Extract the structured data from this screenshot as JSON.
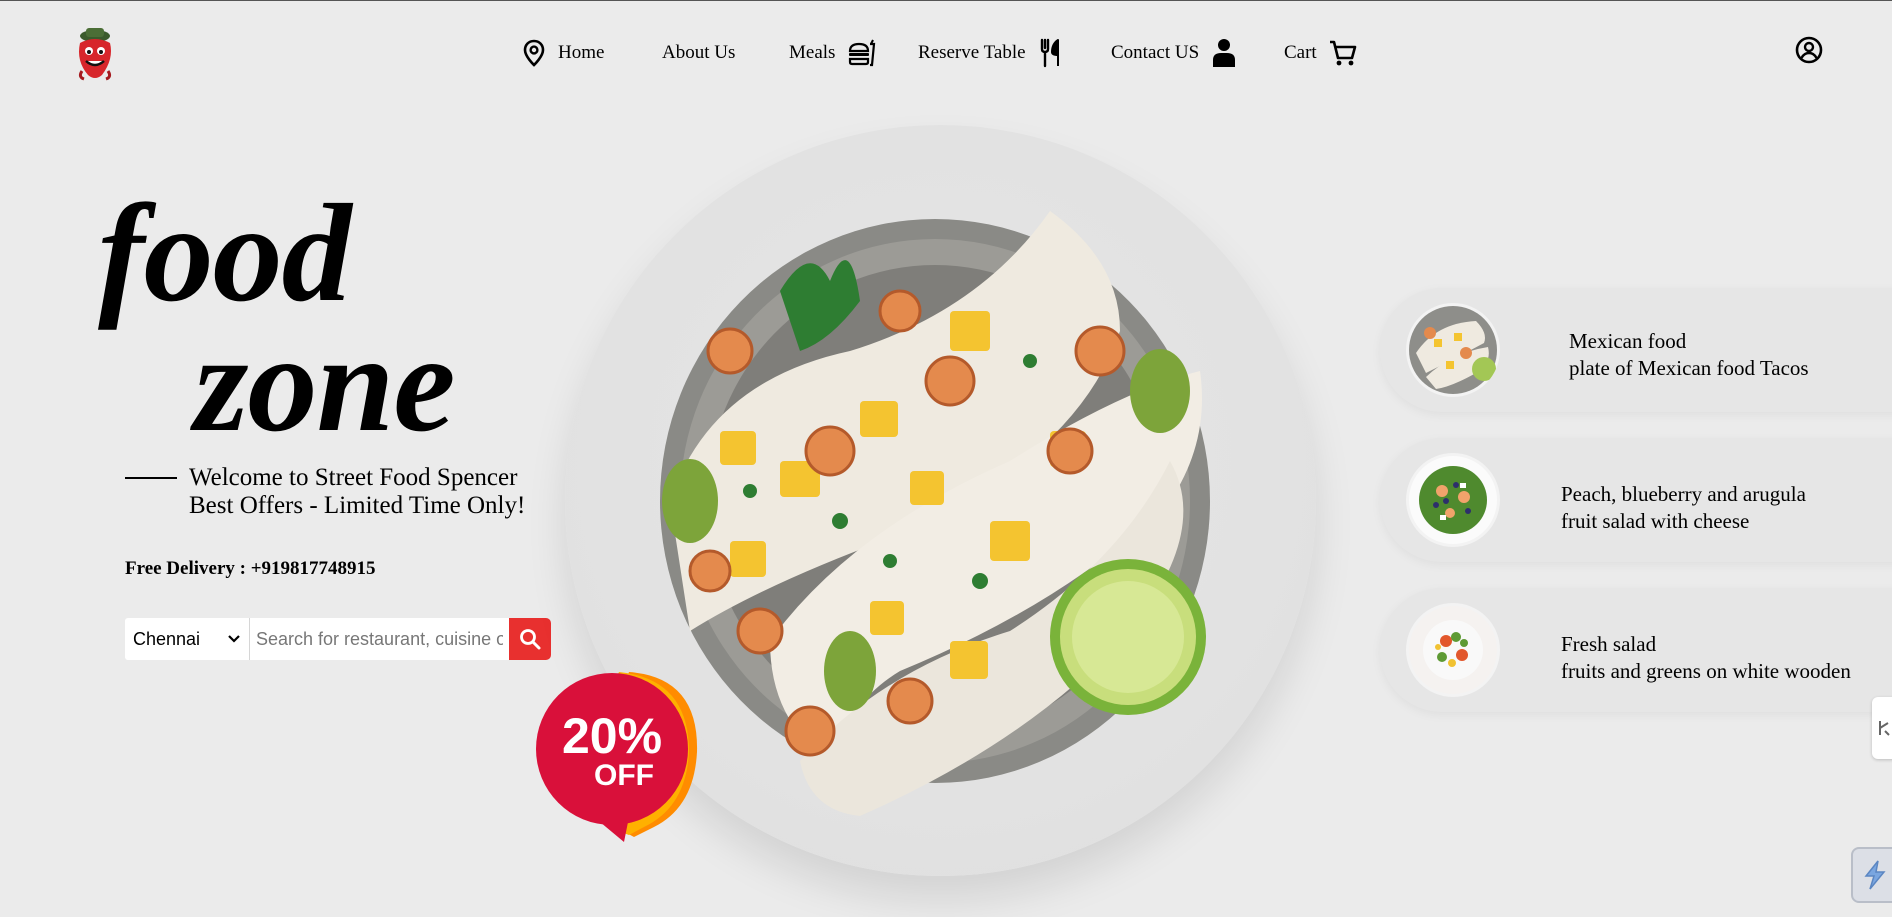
{
  "nav": {
    "items": [
      {
        "label": "Home",
        "icon": "location-pin-icon"
      },
      {
        "label": "About Us"
      },
      {
        "label": "Meals",
        "icon": "burger-icon"
      },
      {
        "label": "Reserve Table",
        "icon": "fork-knife-icon"
      },
      {
        "label": "Contact US",
        "icon": "person-icon"
      },
      {
        "label": "Cart",
        "icon": "cart-icon"
      }
    ],
    "profile_icon": "user-circle-icon"
  },
  "hero": {
    "title_line1": "food",
    "title_line2": "zone",
    "welcome_line1": "Welcome to Street Food Spencer",
    "welcome_line2": "Best Offers - Limited Time Only!",
    "delivery": "Free Delivery : +919817748915"
  },
  "search": {
    "city": "Chennai",
    "placeholder": "Search for restaurant, cuisine or a dish"
  },
  "badge": {
    "percent": "20%",
    "label": "OFF"
  },
  "cards": [
    {
      "title": "Mexican food",
      "subtitle": "plate of Mexican food Tacos"
    },
    {
      "title": "Peach, blueberry and arugula",
      "subtitle": "fruit salad with cheese"
    },
    {
      "title": "Fresh salad",
      "subtitle": "fruits and greens on white wooden"
    }
  ],
  "colors": {
    "background": "#ebebeb",
    "accent_red": "#e8302f",
    "badge_red": "#d9103a",
    "badge_orange": "#ff8c00"
  }
}
